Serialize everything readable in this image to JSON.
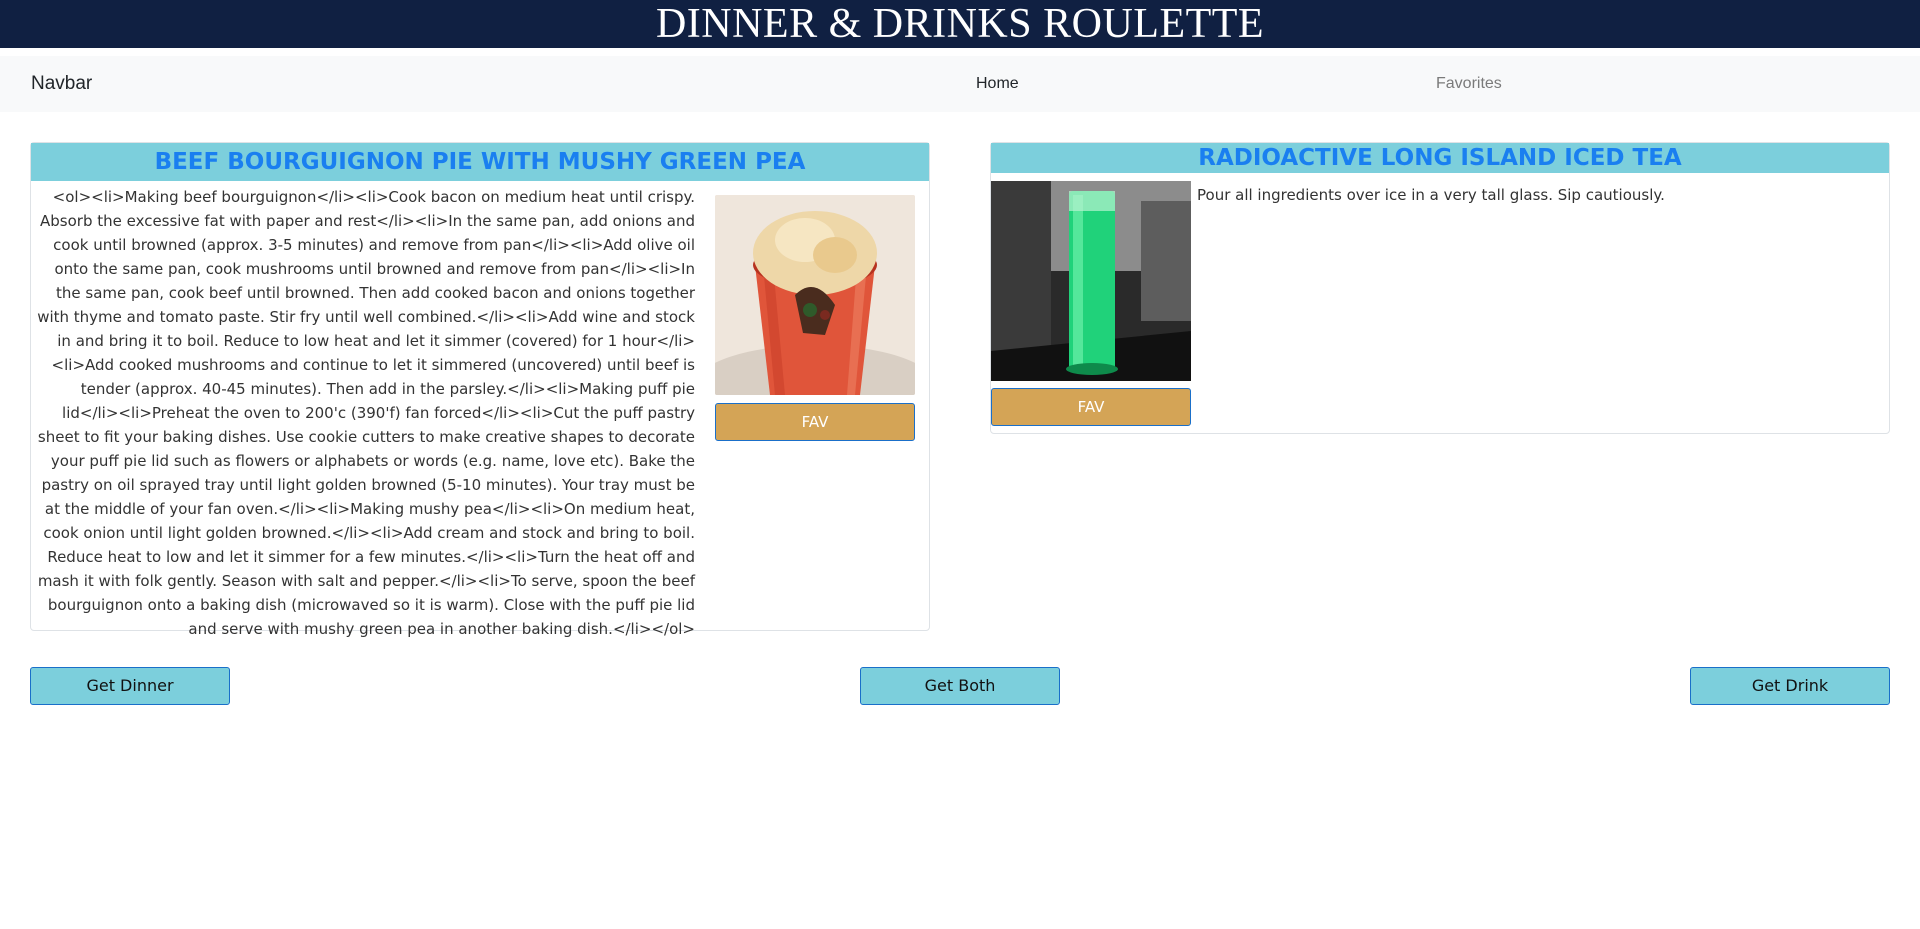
{
  "banner": {
    "title": "DINNER & DRINKS ROULETTE"
  },
  "navbar": {
    "brand": "Navbar",
    "home": "Home",
    "favorites": "Favorites"
  },
  "dinner": {
    "title": "BEEF BOURGUIGNON PIE WITH MUSHY GREEN PEA",
    "instructions": "<ol><li>Making beef bourguignon</li><li>Cook bacon on medium heat until crispy. Absorb the excessive fat with paper and rest</li><li>In the same pan, add onions and cook until browned (approx. 3-5 minutes) and remove from pan</li><li>Add olive oil onto the same pan, cook mushrooms until browned and remove from pan</li><li>In the same pan, cook beef until browned. Then add cooked bacon and onions together with thyme and tomato paste. Stir fry until well combined.</li><li>Add wine and stock in and bring it to boil. Reduce to low heat and let it simmer (covered) for 1 hour</li><li>Add cooked mushrooms and continue to let it simmered (uncovered) until beef is tender (approx. 40-45 minutes). Then add in the parsley.</li><li>Making puff pie lid</li><li>Preheat the oven to 200'c (390'f) fan forced</li><li>Cut the puff pastry sheet to fit your baking dishes. Use cookie cutters to make creative shapes to decorate your puff pie lid such as flowers or alphabets or words (e.g. name, love etc). Bake the pastry on oil sprayed tray until light golden browned (5-10 minutes). Your tray must be at the middle of your fan oven.</li><li>Making mushy pea</li><li>On medium heat, cook onion until light golden browned.</li><li>Add cream and stock and bring to boil. Reduce heat to low and let it simmer for a few minutes.</li><li>Turn the heat off and mash it with folk gently. Season with salt and pepper.</li><li>To serve, spoon the beef bourguignon onto a baking dish (microwaved so it is warm). Close with the puff pie lid and serve with mushy green pea in another baking dish.</li></ol>",
    "fav_label": "FAV"
  },
  "drink": {
    "title": "RADIOACTIVE LONG ISLAND ICED TEA",
    "instructions": "Pour all ingredients over ice in a very tall glass. Sip cautiously.",
    "fav_label": "FAV"
  },
  "actions": {
    "dinner": "Get Dinner",
    "both": "Get Both",
    "drink": "Get Drink"
  },
  "colors": {
    "banner": "#102042",
    "title_bar": "#7ccfdc",
    "title_text": "#1a7ff0",
    "fav": "#d4a456",
    "button": "#7ccfdc"
  }
}
